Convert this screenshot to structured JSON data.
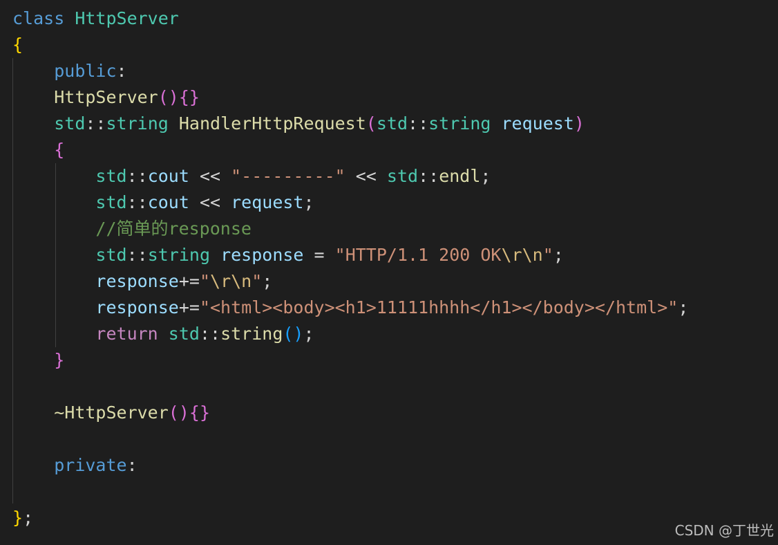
{
  "editor": {
    "theme": "dark",
    "background": "#1e1e1e",
    "lines": [
      {
        "id": "class-decl",
        "tokens": [
          [
            "kw",
            "class"
          ],
          [
            "op",
            " "
          ],
          [
            "type",
            "HttpServer"
          ]
        ]
      },
      {
        "id": "class-open-brace",
        "tokens": [
          [
            "b1",
            "{"
          ]
        ]
      },
      {
        "id": "public-label",
        "tokens": [
          [
            "op",
            "    "
          ],
          [
            "kw",
            "public"
          ],
          [
            "op",
            ":"
          ]
        ]
      },
      {
        "id": "ctor",
        "tokens": [
          [
            "op",
            "    "
          ],
          [
            "fn",
            "HttpServer"
          ],
          [
            "b2",
            "()"
          ],
          [
            "b2",
            "{}"
          ]
        ]
      },
      {
        "id": "handler-signature",
        "tokens": [
          [
            "op",
            "    "
          ],
          [
            "type",
            "std"
          ],
          [
            "op",
            "::"
          ],
          [
            "type",
            "string"
          ],
          [
            "op",
            " "
          ],
          [
            "fn",
            "HandlerHttpRequest"
          ],
          [
            "b2",
            "("
          ],
          [
            "type",
            "std"
          ],
          [
            "op",
            "::"
          ],
          [
            "type",
            "string"
          ],
          [
            "op",
            " "
          ],
          [
            "var",
            "request"
          ],
          [
            "b2",
            ")"
          ]
        ]
      },
      {
        "id": "handler-open-brace",
        "tokens": [
          [
            "op",
            "    "
          ],
          [
            "b2",
            "{"
          ]
        ]
      },
      {
        "id": "cout-separator",
        "tokens": [
          [
            "op",
            "        "
          ],
          [
            "type",
            "std"
          ],
          [
            "op",
            "::"
          ],
          [
            "var",
            "cout"
          ],
          [
            "op",
            " << "
          ],
          [
            "str",
            "\"---------\""
          ],
          [
            "op",
            " << "
          ],
          [
            "type",
            "std"
          ],
          [
            "op",
            "::"
          ],
          [
            "fn",
            "endl"
          ],
          [
            "op",
            ";"
          ]
        ]
      },
      {
        "id": "cout-request",
        "tokens": [
          [
            "op",
            "        "
          ],
          [
            "type",
            "std"
          ],
          [
            "op",
            "::"
          ],
          [
            "var",
            "cout"
          ],
          [
            "op",
            " << "
          ],
          [
            "var",
            "request"
          ],
          [
            "op",
            ";"
          ]
        ]
      },
      {
        "id": "comment",
        "tokens": [
          [
            "op",
            "        "
          ],
          [
            "cmt",
            "//简单的response"
          ]
        ]
      },
      {
        "id": "response-decl",
        "tokens": [
          [
            "op",
            "        "
          ],
          [
            "type",
            "std"
          ],
          [
            "op",
            "::"
          ],
          [
            "type",
            "string"
          ],
          [
            "op",
            " "
          ],
          [
            "var",
            "response"
          ],
          [
            "op",
            " = "
          ],
          [
            "str",
            "\"HTTP/1.1 200 OK"
          ],
          [
            "esc",
            "\\r\\n"
          ],
          [
            "str",
            "\""
          ],
          [
            "op",
            ";"
          ]
        ]
      },
      {
        "id": "response-crlf",
        "tokens": [
          [
            "op",
            "        "
          ],
          [
            "var",
            "response"
          ],
          [
            "op",
            "+="
          ],
          [
            "str",
            "\""
          ],
          [
            "esc",
            "\\r\\n"
          ],
          [
            "str",
            "\""
          ],
          [
            "op",
            ";"
          ]
        ]
      },
      {
        "id": "response-body",
        "tokens": [
          [
            "op",
            "        "
          ],
          [
            "var",
            "response"
          ],
          [
            "op",
            "+="
          ],
          [
            "str",
            "\"<html><body><h1>11111hhhh</h1></body></html>\""
          ],
          [
            "op",
            ";"
          ]
        ]
      },
      {
        "id": "return-stmt",
        "tokens": [
          [
            "op",
            "        "
          ],
          [
            "ctrl",
            "return"
          ],
          [
            "op",
            " "
          ],
          [
            "type",
            "std"
          ],
          [
            "op",
            "::"
          ],
          [
            "fn",
            "string"
          ],
          [
            "b3",
            "()"
          ],
          [
            "op",
            ";"
          ]
        ]
      },
      {
        "id": "handler-close-brace",
        "tokens": [
          [
            "op",
            "    "
          ],
          [
            "b2",
            "}"
          ]
        ]
      },
      {
        "id": "blank-1",
        "tokens": []
      },
      {
        "id": "dtor",
        "tokens": [
          [
            "op",
            "    "
          ],
          [
            "fn",
            "~HttpServer"
          ],
          [
            "b2",
            "()"
          ],
          [
            "b2",
            "{}"
          ]
        ]
      },
      {
        "id": "blank-2",
        "tokens": []
      },
      {
        "id": "private-label",
        "tokens": [
          [
            "op",
            "    "
          ],
          [
            "kw",
            "private"
          ],
          [
            "op",
            ":"
          ]
        ]
      },
      {
        "id": "blank-3",
        "tokens": []
      },
      {
        "id": "class-close",
        "tokens": [
          [
            "b1",
            "}"
          ],
          [
            "op",
            ";"
          ]
        ]
      }
    ]
  },
  "watermark": "CSDN @丁世光"
}
